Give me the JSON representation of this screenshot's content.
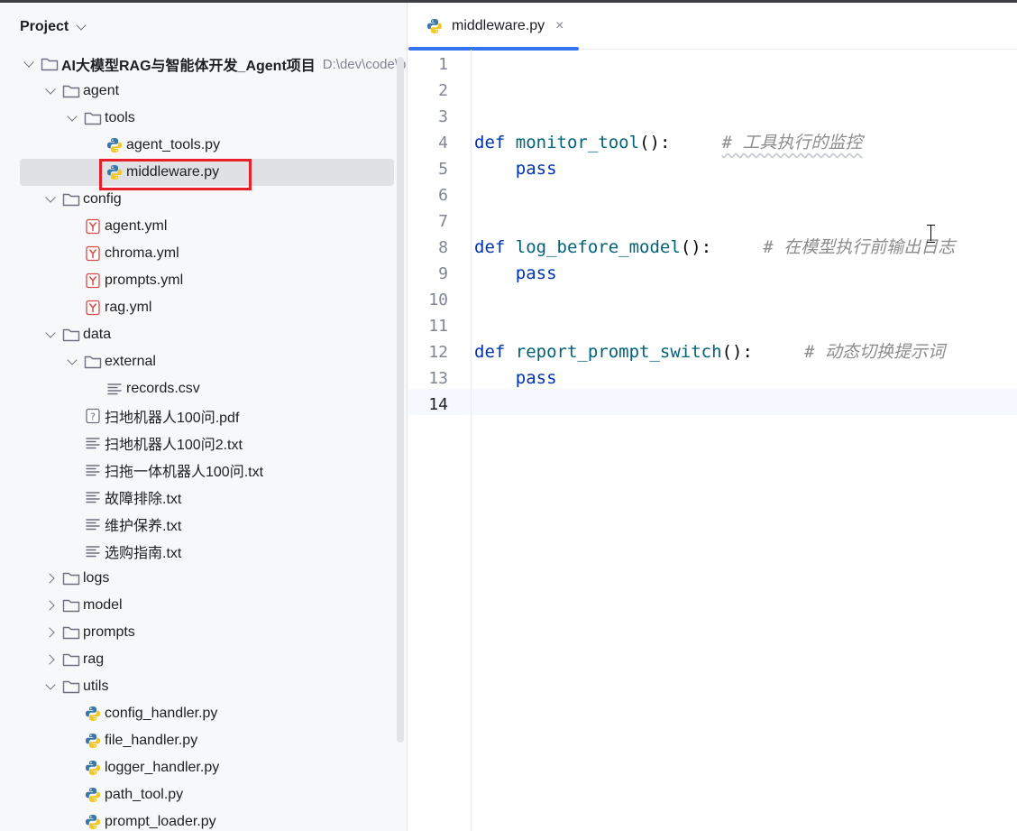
{
  "project_panel": {
    "title": "Project",
    "tree": [
      {
        "label": "AI大模型RAG与智能体开发_Agent项目",
        "path": "D:\\dev\\code\\p",
        "type": "folder",
        "depth": 0,
        "expanded": true,
        "bold": true
      },
      {
        "label": "agent",
        "type": "folder",
        "depth": 1,
        "expanded": true
      },
      {
        "label": "tools",
        "type": "folder",
        "depth": 2,
        "expanded": true
      },
      {
        "label": "agent_tools.py",
        "type": "python",
        "depth": 3
      },
      {
        "label": "middleware.py",
        "type": "python",
        "depth": 3,
        "selected": true
      },
      {
        "label": "config",
        "type": "folder",
        "depth": 1,
        "expanded": true
      },
      {
        "label": "agent.yml",
        "type": "yaml",
        "depth": 2
      },
      {
        "label": "chroma.yml",
        "type": "yaml",
        "depth": 2
      },
      {
        "label": "prompts.yml",
        "type": "yaml",
        "depth": 2
      },
      {
        "label": "rag.yml",
        "type": "yaml",
        "depth": 2
      },
      {
        "label": "data",
        "type": "folder",
        "depth": 1,
        "expanded": true
      },
      {
        "label": "external",
        "type": "folder",
        "depth": 2,
        "expanded": true
      },
      {
        "label": "records.csv",
        "type": "text",
        "depth": 3
      },
      {
        "label": "扫地机器人100问.pdf",
        "type": "unknown",
        "depth": 2
      },
      {
        "label": "扫地机器人100问2.txt",
        "type": "text",
        "depth": 2
      },
      {
        "label": "扫拖一体机器人100问.txt",
        "type": "text",
        "depth": 2
      },
      {
        "label": "故障排除.txt",
        "type": "text",
        "depth": 2
      },
      {
        "label": "维护保养.txt",
        "type": "text",
        "depth": 2
      },
      {
        "label": "选购指南.txt",
        "type": "text",
        "depth": 2
      },
      {
        "label": "logs",
        "type": "folder",
        "depth": 1,
        "expanded": false
      },
      {
        "label": "model",
        "type": "folder",
        "depth": 1,
        "expanded": false
      },
      {
        "label": "prompts",
        "type": "folder",
        "depth": 1,
        "expanded": false
      },
      {
        "label": "rag",
        "type": "folder",
        "depth": 1,
        "expanded": false
      },
      {
        "label": "utils",
        "type": "folder",
        "depth": 1,
        "expanded": true
      },
      {
        "label": "config_handler.py",
        "type": "python",
        "depth": 2
      },
      {
        "label": "file_handler.py",
        "type": "python",
        "depth": 2
      },
      {
        "label": "logger_handler.py",
        "type": "python",
        "depth": 2
      },
      {
        "label": "path_tool.py",
        "type": "python",
        "depth": 2
      },
      {
        "label": "prompt_loader.py",
        "type": "python",
        "depth": 2
      }
    ]
  },
  "editor": {
    "active_tab": {
      "label": "middleware.py",
      "close": "×"
    },
    "current_line": 14,
    "lines": [
      {
        "n": "1",
        "tokens": []
      },
      {
        "n": "2",
        "tokens": []
      },
      {
        "n": "3",
        "tokens": []
      },
      {
        "n": "4",
        "tokens": [
          {
            "t": "def",
            "c": "kw"
          },
          {
            "t": " ",
            "c": ""
          },
          {
            "t": "monitor_tool",
            "c": "fn"
          },
          {
            "t": "():",
            "c": ""
          },
          {
            "t": "     ",
            "c": ""
          },
          {
            "t": "# 工具执行的监控",
            "c": "cm"
          }
        ]
      },
      {
        "n": "5",
        "tokens": [
          {
            "t": "    ",
            "c": ""
          },
          {
            "t": "pass",
            "c": "kw"
          }
        ]
      },
      {
        "n": "6",
        "tokens": []
      },
      {
        "n": "7",
        "tokens": []
      },
      {
        "n": "8",
        "tokens": [
          {
            "t": "def",
            "c": "kw"
          },
          {
            "t": " ",
            "c": ""
          },
          {
            "t": "log_before_model",
            "c": "fn"
          },
          {
            "t": "():",
            "c": ""
          },
          {
            "t": "     ",
            "c": ""
          },
          {
            "t": "# 在模型执行前输出日志",
            "c": "cm"
          }
        ]
      },
      {
        "n": "9",
        "tokens": [
          {
            "t": "    ",
            "c": ""
          },
          {
            "t": "pass",
            "c": "kw"
          }
        ]
      },
      {
        "n": "10",
        "tokens": []
      },
      {
        "n": "11",
        "tokens": []
      },
      {
        "n": "12",
        "tokens": [
          {
            "t": "def",
            "c": "kw"
          },
          {
            "t": " ",
            "c": ""
          },
          {
            "t": "report_prompt_switch",
            "c": "fn"
          },
          {
            "t": "():",
            "c": ""
          },
          {
            "t": "     ",
            "c": ""
          },
          {
            "t": "# 动态切换提示词",
            "c": "cm"
          }
        ]
      },
      {
        "n": "13",
        "tokens": [
          {
            "t": "    ",
            "c": ""
          },
          {
            "t": "pass",
            "c": "kw"
          }
        ]
      },
      {
        "n": "14",
        "tokens": []
      }
    ]
  },
  "colors": {
    "accent": "#3574f0",
    "selection_outline": "#e8202a",
    "keyword": "#0033b3",
    "function": "#00627a",
    "comment": "#8c8c8c"
  }
}
